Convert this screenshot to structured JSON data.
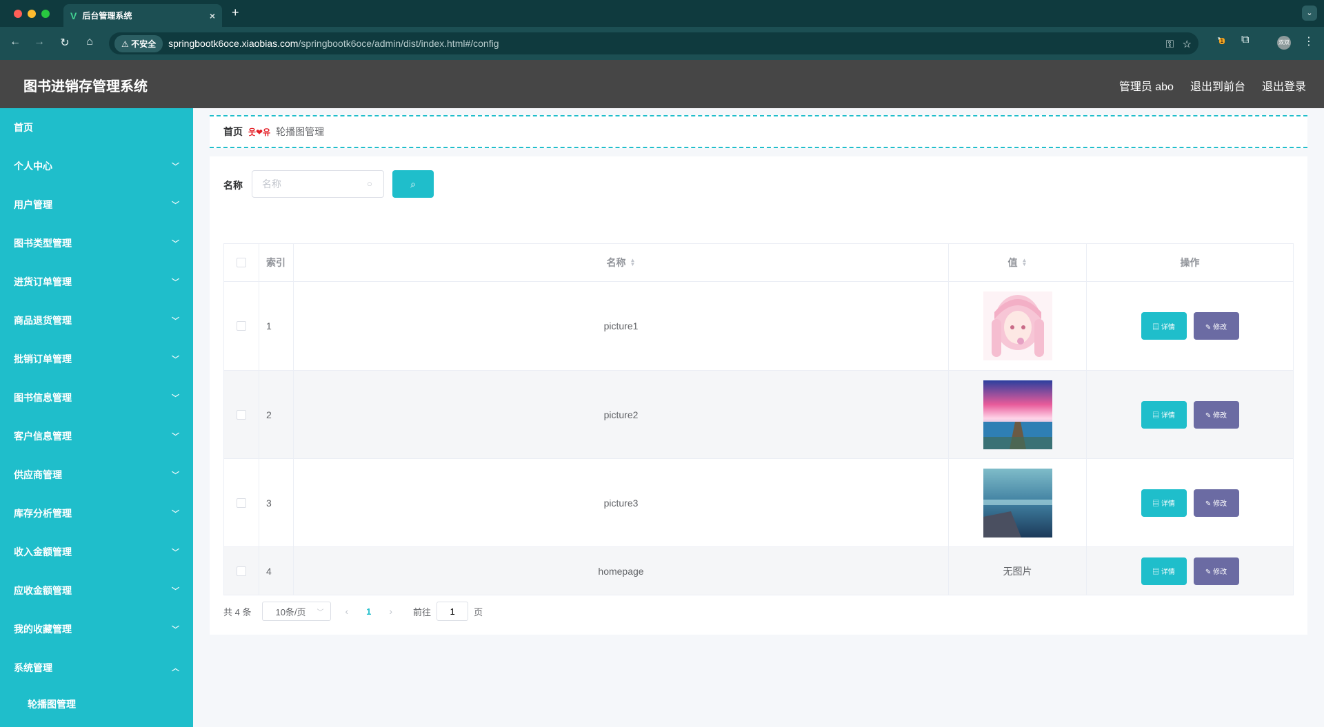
{
  "browser": {
    "tab_favicon": "V",
    "tab_title": "后台管理系统",
    "tab_close": "×",
    "new_tab": "+",
    "insecure_label": "不安全",
    "url_host": "springbootk6oce.xiaobias.com",
    "url_path": "/springbootk6oce/admin/dist/index.html#/config",
    "extension_badge": "1",
    "profile_label": "双双"
  },
  "header": {
    "title": "图书进销存管理系统",
    "user": "管理员 abo",
    "front_link": "退出到前台",
    "logout_link": "退出登录"
  },
  "sidebar": {
    "items": [
      {
        "label": "首页"
      },
      {
        "label": "个人中心"
      },
      {
        "label": "用户管理"
      },
      {
        "label": "图书类型管理"
      },
      {
        "label": "进货订单管理"
      },
      {
        "label": "商品退货管理"
      },
      {
        "label": "批销订单管理"
      },
      {
        "label": "图书信息管理"
      },
      {
        "label": "客户信息管理"
      },
      {
        "label": "供应商管理"
      },
      {
        "label": "库存分析管理"
      },
      {
        "label": "收入金额管理"
      },
      {
        "label": "应收金额管理"
      },
      {
        "label": "我的收藏管理"
      },
      {
        "label": "系统管理"
      }
    ],
    "subitem": "轮播图管理"
  },
  "breadcrumb": {
    "home": "首页",
    "separator": "웃❤유",
    "current": "轮播图管理"
  },
  "search": {
    "label": "名称",
    "placeholder": "名称"
  },
  "table": {
    "headers": {
      "index": "索引",
      "name": "名称",
      "value": "值",
      "ops": "操作"
    },
    "rows": [
      {
        "index": "1",
        "name": "picture1",
        "value_type": "image",
        "image_theme": "pink-anime-girl"
      },
      {
        "index": "2",
        "name": "picture2",
        "value_type": "image",
        "image_theme": "sunset-sea-pier"
      },
      {
        "index": "3",
        "name": "picture3",
        "value_type": "image",
        "image_theme": "blue-sea-dock"
      },
      {
        "index": "4",
        "name": "homepage",
        "value_type": "text",
        "value_text": "无图片"
      }
    ],
    "detail_label": "详情",
    "edit_label": "修改"
  },
  "pagination": {
    "total": "共 4 条",
    "page_size": "10条/页",
    "current_page": "1",
    "goto_label": "前往",
    "goto_value": "1",
    "page_suffix": "页"
  },
  "colors": {
    "accent": "#1fbecb",
    "header_bg": "#464646",
    "edit_button": "#6b6ba3",
    "browser_dark": "#0f3a3e"
  }
}
